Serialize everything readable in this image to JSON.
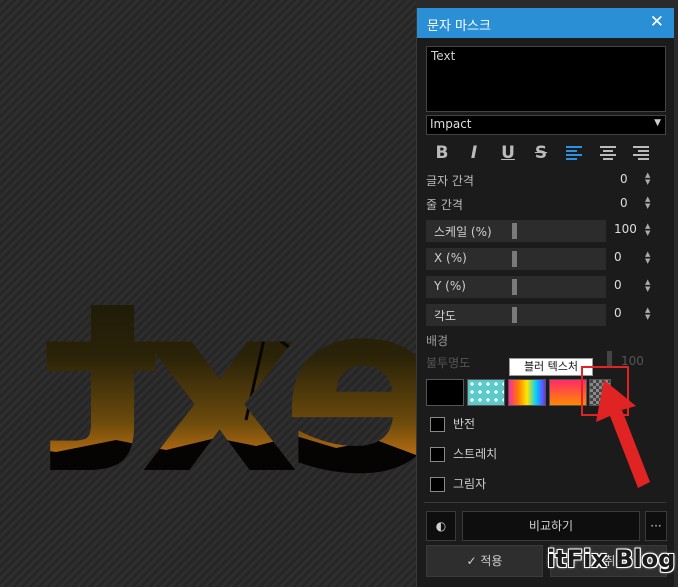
{
  "dialog": {
    "title": "문자 마스크"
  },
  "text_input": {
    "value": "Text"
  },
  "font": {
    "selected": "Impact"
  },
  "format_icons": [
    "bold-icon",
    "italic-icon",
    "underline-icon",
    "strikethrough-icon",
    "align-left-icon",
    "align-center-icon",
    "align-right-icon"
  ],
  "format_labels": [
    "B",
    "I",
    "U",
    "S"
  ],
  "char_spacing": {
    "label": "글자 간격",
    "value": "0"
  },
  "line_spacing": {
    "label": "줄 간격",
    "value": "0"
  },
  "scale": {
    "label": "스케일 (%)",
    "value": "100"
  },
  "x_pos": {
    "label": "X (%)",
    "value": "0"
  },
  "y_pos": {
    "label": "Y (%)",
    "value": "0"
  },
  "angle": {
    "label": "각도",
    "value": "0"
  },
  "background": {
    "label": "배경",
    "opacity_label": "불투명도",
    "opacity_value": "100",
    "tooltip": "블러 텍스처"
  },
  "options": {
    "invert": "반전",
    "stretch": "스트레치",
    "shadow": "그림자"
  },
  "footer": {
    "compare": "비교하기",
    "more": "···",
    "apply": "적용",
    "cancel": "취소"
  },
  "canvas": {
    "text": "ext"
  },
  "watermark": "itFix Blog",
  "colors": {
    "accent": "#2b8fd6",
    "annotation": "#e02424"
  }
}
